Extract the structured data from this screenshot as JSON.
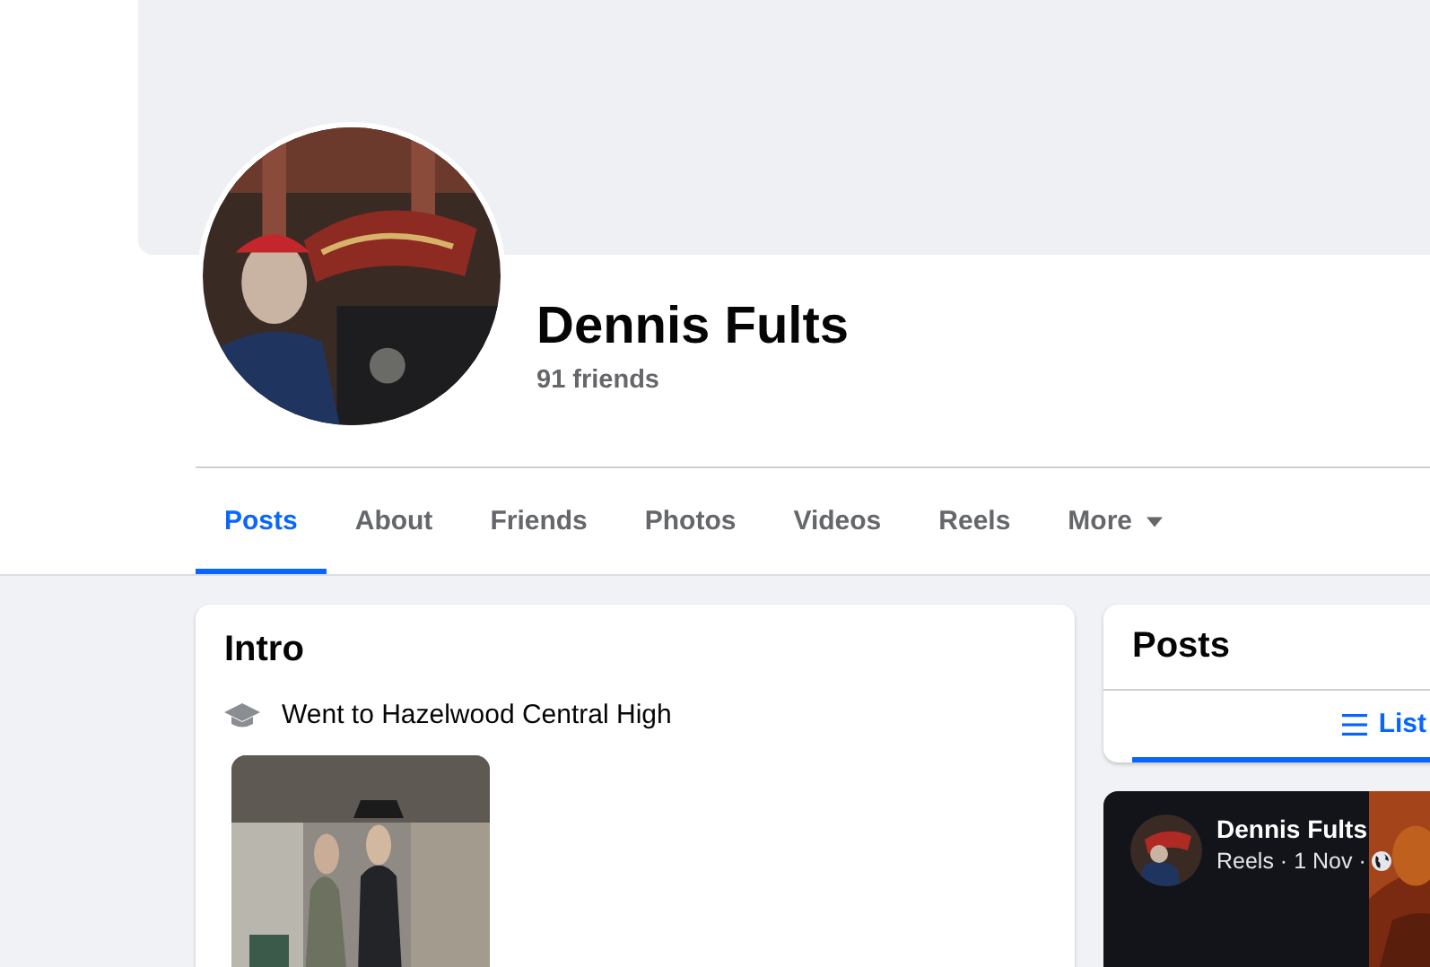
{
  "profile": {
    "name": "Dennis Fults",
    "friends": "91 friends"
  },
  "tabs": [
    {
      "label": "Posts",
      "selected": true,
      "kind": "link"
    },
    {
      "label": "About",
      "selected": false,
      "kind": "link"
    },
    {
      "label": "Friends",
      "selected": false,
      "kind": "link"
    },
    {
      "label": "Photos",
      "selected": false,
      "kind": "link"
    },
    {
      "label": "Videos",
      "selected": false,
      "kind": "link"
    },
    {
      "label": "Reels",
      "selected": false,
      "kind": "link"
    },
    {
      "label": "More",
      "selected": false,
      "kind": "dropdown"
    }
  ],
  "intro": {
    "title": "Intro",
    "items": [
      {
        "text": "Went to Hazelwood Central High",
        "kind": "education"
      }
    ]
  },
  "posts": {
    "title": "Posts",
    "view_tabs": [
      {
        "label": "List",
        "selected": true
      }
    ],
    "items": [
      {
        "author": "Dennis Fults",
        "meta": "Reels · 1 Nov ·",
        "kind": "reel"
      }
    ]
  }
}
